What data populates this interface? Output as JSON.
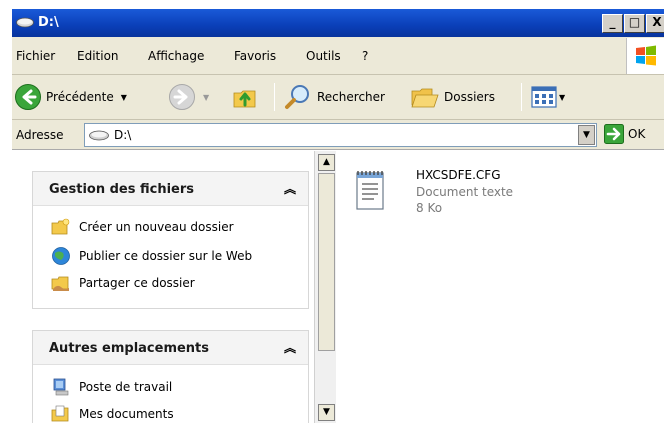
{
  "window": {
    "title": "D:\\",
    "min_label": "_",
    "max_label": "□",
    "close_label": "X"
  },
  "menu": {
    "items": [
      "Fichier",
      "Edition",
      "Affichage",
      "Favoris",
      "Outils",
      "?"
    ]
  },
  "toolbar": {
    "back_label": "Précédente",
    "search_label": "Rechercher",
    "folders_label": "Dossiers"
  },
  "address": {
    "label": "Adresse",
    "value": "D:\\",
    "go_label": "OK"
  },
  "taskpane": {
    "file_tasks": {
      "title": "Gestion des fichiers",
      "items": [
        {
          "label": "Créer un nouveau dossier",
          "icon": "new-folder-icon"
        },
        {
          "label": "Publier ce dossier sur le Web",
          "icon": "publish-web-icon"
        },
        {
          "label": "Partager ce dossier",
          "icon": "share-folder-icon"
        }
      ]
    },
    "other_places": {
      "title": "Autres emplacements",
      "items": [
        {
          "label": "Poste de travail",
          "icon": "my-computer-icon"
        },
        {
          "label": "Mes documents",
          "icon": "my-documents-icon"
        }
      ]
    }
  },
  "files": [
    {
      "name": "HXCSDFE.CFG",
      "type": "Document texte",
      "size": "8 Ko",
      "icon": "text-document-icon"
    }
  ],
  "colors": {
    "titlebar": "#0a3fb8",
    "chrome": "#ece9d8",
    "secondary_text": "#7a7a7a"
  }
}
